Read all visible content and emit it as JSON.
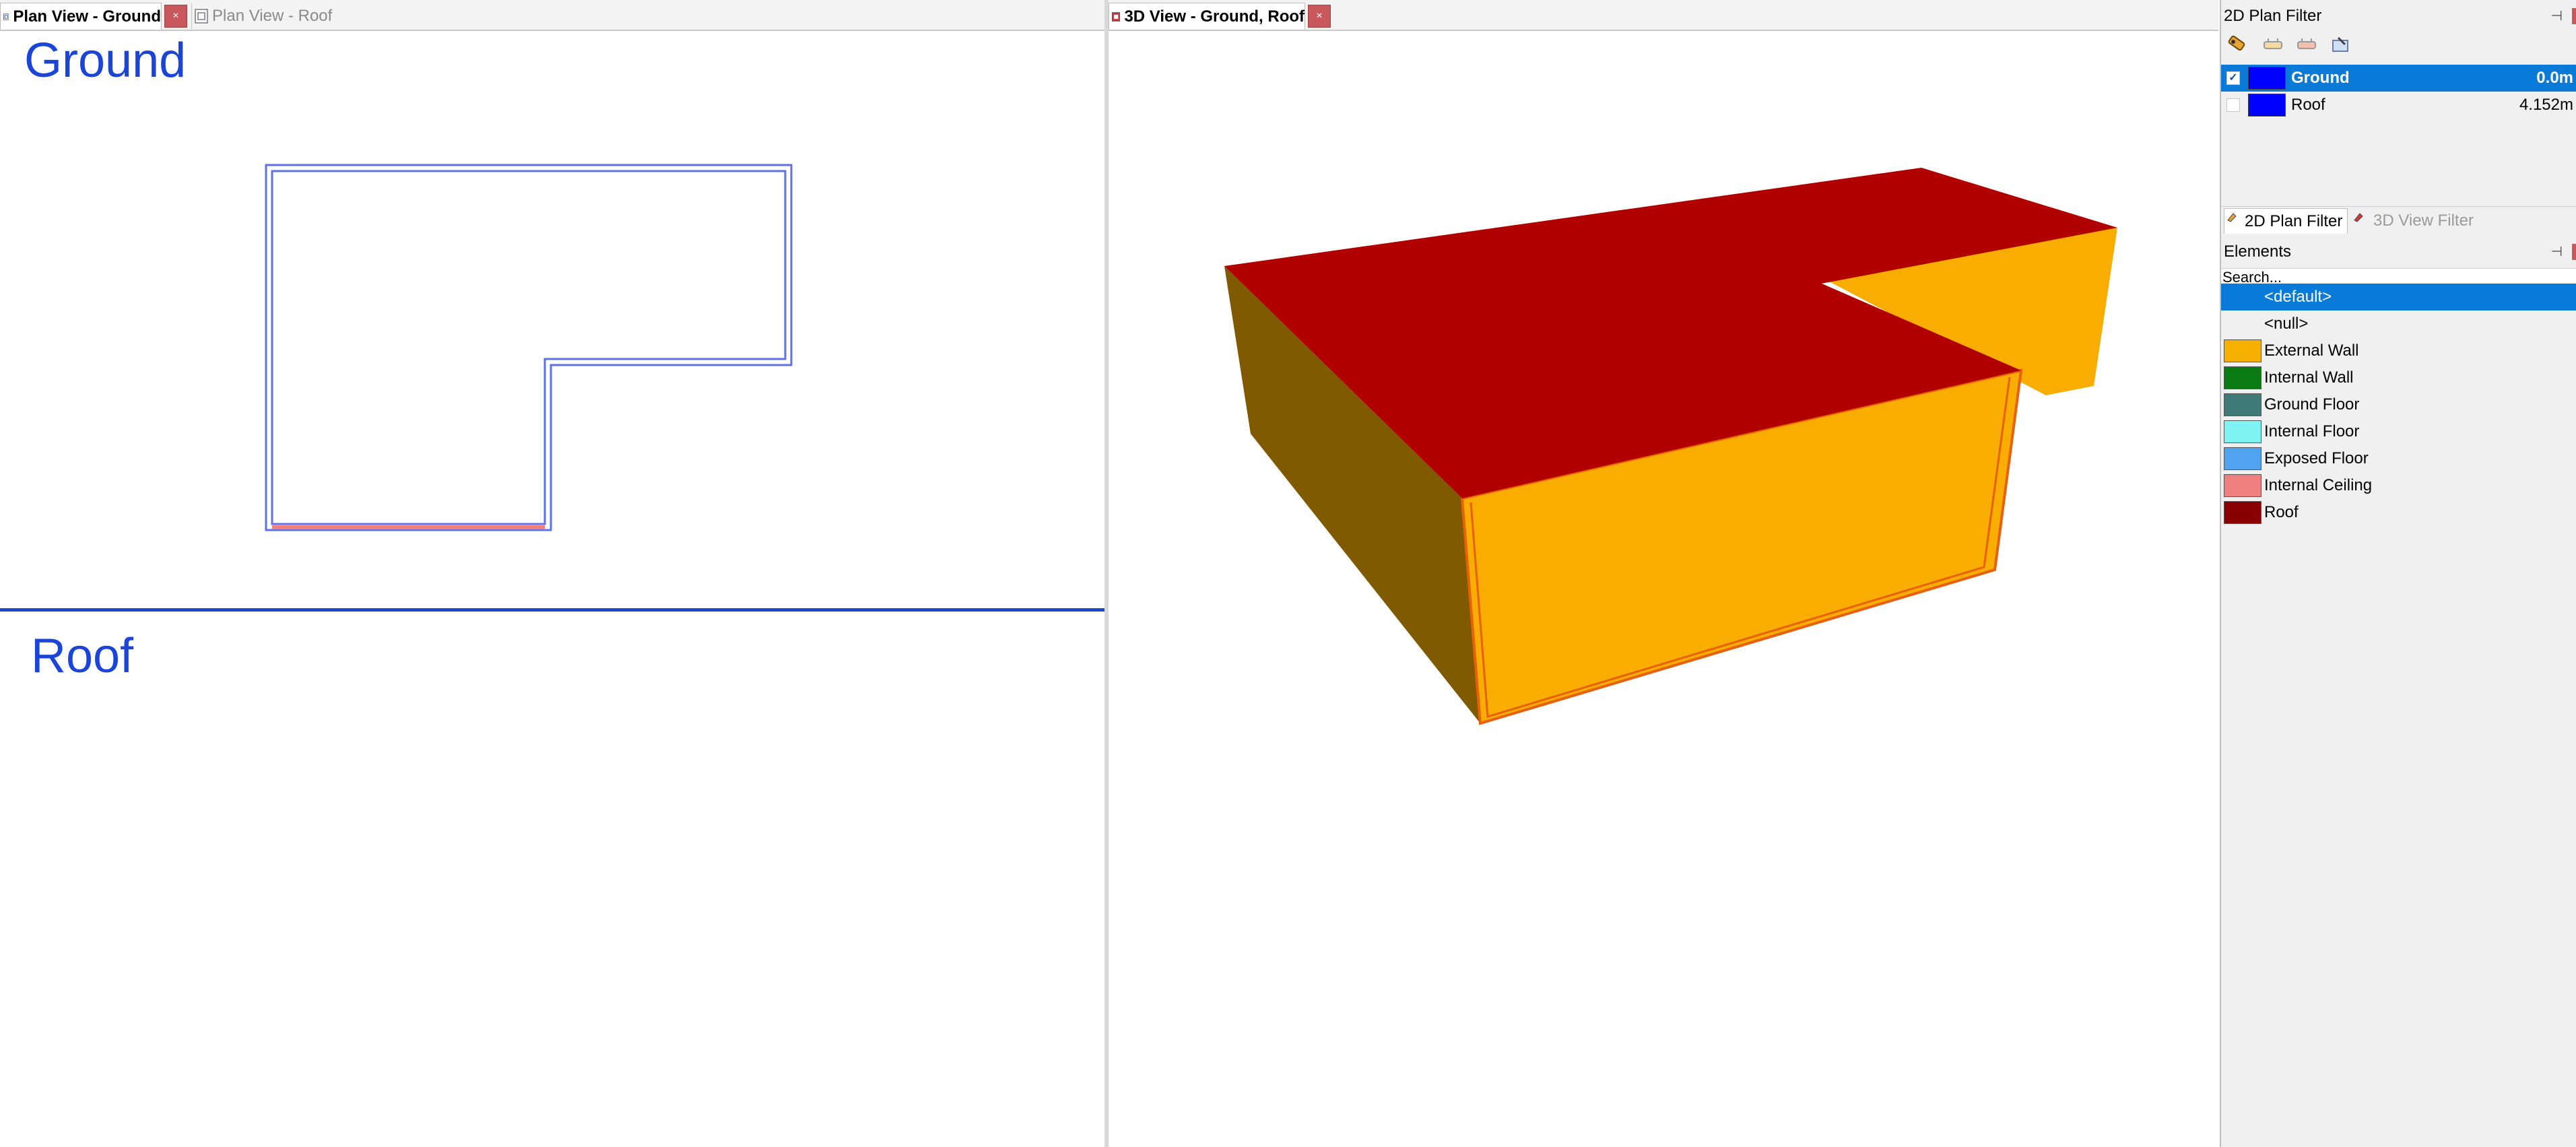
{
  "tabs_left": {
    "tab1": "Plan View - Ground",
    "tab2": "Plan View - Roof",
    "close": "×"
  },
  "tabs_middle": {
    "tab1": "3D View - Ground, Roof",
    "close": "×"
  },
  "plan": {
    "level1": "Ground",
    "level2": "Roof"
  },
  "plan_filter": {
    "title": "2D Plan Filter",
    "pin": "⊣",
    "levels": [
      {
        "name": "Ground",
        "height": "0.0m",
        "checked": "✓",
        "color": "#0000ff"
      },
      {
        "name": "Roof",
        "height": "4.152m",
        "checked": "",
        "color": "#0000ff"
      }
    ],
    "tab_plan": "2D Plan Filter",
    "tab_3d": "3D View Filter"
  },
  "elements": {
    "title": "Elements",
    "pin": "⊣",
    "search_placeholder": "Search...",
    "items": [
      {
        "name": "<default>",
        "color": ""
      },
      {
        "name": "<null>",
        "color": ""
      },
      {
        "name": "External Wall",
        "color": "#f5b000"
      },
      {
        "name": "Internal Wall",
        "color": "#0a7a12"
      },
      {
        "name": "Ground Floor",
        "color": "#3f7a78"
      },
      {
        "name": "Internal Floor",
        "color": "#7ff3f3"
      },
      {
        "name": "Exposed Floor",
        "color": "#4fa3ef"
      },
      {
        "name": "Internal Ceiling",
        "color": "#f08080"
      },
      {
        "name": "Roof",
        "color": "#8a0000"
      }
    ]
  },
  "colors": {
    "roof": "#b00000",
    "wall_front": "#f8ad00",
    "wall_side": "#7f5a00",
    "accent": "#0a7ad9",
    "level_label": "#1a45d6"
  }
}
